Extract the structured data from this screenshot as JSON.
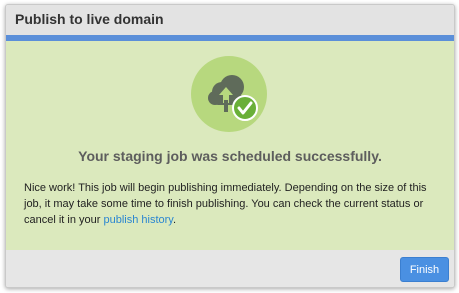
{
  "dialog": {
    "title": "Publish to live domain"
  },
  "colors": {
    "accent": "#5b8fd9",
    "success_background": "#dbe9bd",
    "icon_circle": "#b7d87e",
    "check_badge": "#6aaf38",
    "button": "#4a90e2",
    "link": "#2a86d1"
  },
  "icons": {
    "main": "cloud-upload-icon",
    "badge": "checkmark-icon"
  },
  "content": {
    "heading": "Your staging job was scheduled successfully.",
    "message_before_link": "Nice work! This job will begin publishing immediately. Depending on the size of this job, it may take some time to finish publishing. You can check the current status or cancel it in your ",
    "link_text": "publish history",
    "message_after_link": "."
  },
  "footer": {
    "finish_label": "Finish"
  }
}
